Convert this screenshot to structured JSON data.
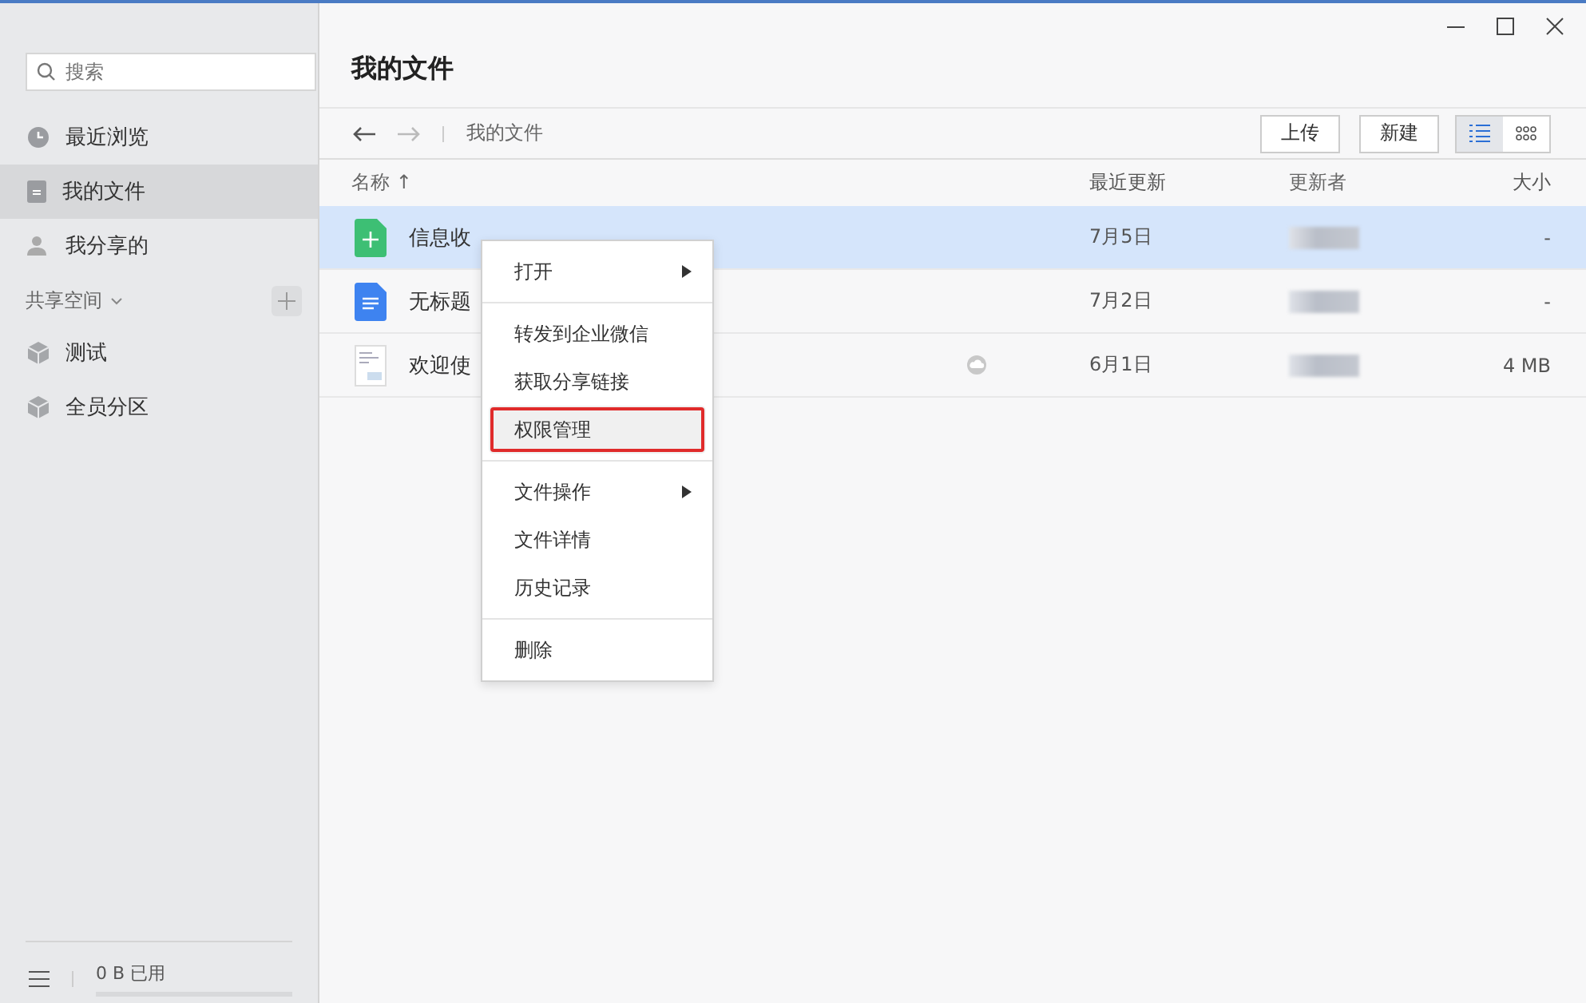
{
  "sidebar": {
    "search": {
      "placeholder": "搜索"
    },
    "items": [
      {
        "label": "最近浏览",
        "kind": "clock",
        "selected": false
      },
      {
        "label": "我的文件",
        "kind": "doc",
        "selected": true
      },
      {
        "label": "我分享的",
        "kind": "person",
        "selected": false
      }
    ],
    "section": {
      "label": "共享空间",
      "expanded": true
    },
    "spaces": [
      {
        "label": "测试"
      },
      {
        "label": "全员分区"
      }
    ],
    "storage": {
      "text": "0 B 已用"
    }
  },
  "main": {
    "title": "我的文件",
    "breadcrumb": "我的文件",
    "buttons": [
      "上传",
      "新建"
    ],
    "view_buttons": [
      {
        "kind": "list",
        "selected": true
      },
      {
        "kind": "grid",
        "selected": false
      }
    ],
    "columns": [
      "名称",
      "最近更新",
      "更新者",
      "大小"
    ],
    "sort_arrow": "↑",
    "rows": [
      {
        "name": "信息收",
        "kind": "sheet",
        "date": "7月5日",
        "size": "-",
        "selected": true,
        "cloud": false
      },
      {
        "name": "无标题",
        "kind": "doc",
        "date": "7月2日",
        "size": "-",
        "selected": false,
        "cloud": false
      },
      {
        "name": "欢迎使",
        "kind": "pdf",
        "date": "6月1日",
        "size": "4 MB",
        "selected": false,
        "cloud": true
      }
    ]
  },
  "context_menu": {
    "sections": [
      [
        {
          "label": "打开",
          "submenu": true,
          "highlighted": false
        }
      ],
      [
        {
          "label": "转发到企业微信",
          "submenu": false,
          "highlighted": false
        },
        {
          "label": "获取分享链接",
          "submenu": false,
          "highlighted": false
        },
        {
          "label": "权限管理",
          "submenu": false,
          "highlighted": true
        }
      ],
      [
        {
          "label": "文件操作",
          "submenu": true,
          "highlighted": false
        },
        {
          "label": "文件详情",
          "submenu": false,
          "highlighted": false
        },
        {
          "label": "历史记录",
          "submenu": false,
          "highlighted": false
        }
      ],
      [
        {
          "label": "删除",
          "submenu": false,
          "highlighted": false
        }
      ]
    ]
  }
}
